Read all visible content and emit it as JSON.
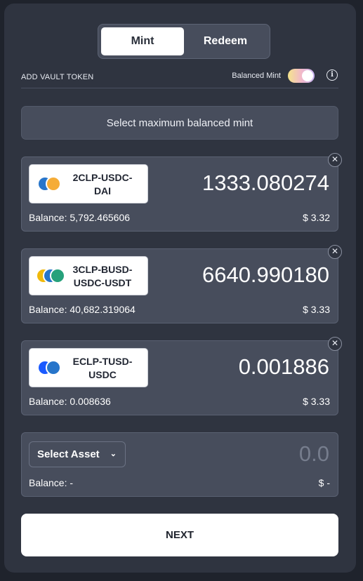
{
  "tabs": {
    "mint": "Mint",
    "redeem": "Redeem",
    "active": "mint"
  },
  "vault": {
    "label": "ADD VAULT TOKEN",
    "balanced_mint_label": "Balanced Mint",
    "balanced_mint_enabled": true,
    "info_icon": "info-icon"
  },
  "max_button": "Select maximum balanced mint",
  "tokens": [
    {
      "name": "2CLP-USDC-DAI",
      "name_line1": "2CLP-USDC-",
      "name_line2": "DAI",
      "amount": "1333.080274",
      "balance": "Balance: 5,792.465606",
      "usd": "$ 3.32",
      "icons": [
        "usdc-coin-icon",
        "dai-coin-icon"
      ]
    },
    {
      "name": "3CLP-BUSD-USDC-USDT",
      "name_line1": "3CLP-BUSD-",
      "name_line2": "USDC-USDT",
      "amount": "6640.990180",
      "balance": "Balance: 40,682.319064",
      "usd": "$ 3.33",
      "icons": [
        "busd-coin-icon",
        "usdc-coin-icon",
        "usdt-coin-icon"
      ]
    },
    {
      "name": "ECLP-TUSD-USDC",
      "name_line1": "ECLP-TUSD-",
      "name_line2": "USDC",
      "amount": "0.001886",
      "balance": "Balance: 0.008636",
      "usd": "$ 3.33",
      "icons": [
        "tusd-coin-icon",
        "usdc-coin-icon"
      ]
    }
  ],
  "empty_slot": {
    "select_label": "Select Asset",
    "amount_placeholder": "0.0",
    "balance": "Balance: -",
    "usd": "$ -"
  },
  "next_button": "NEXT",
  "colors": {
    "panel": "#2f3440",
    "card": "#474d5c",
    "usdc": "#2775ca",
    "dai": "#f5ac37",
    "busd": "#f0b90b",
    "usdt": "#26a17b",
    "tusd": "#1a5aff"
  }
}
